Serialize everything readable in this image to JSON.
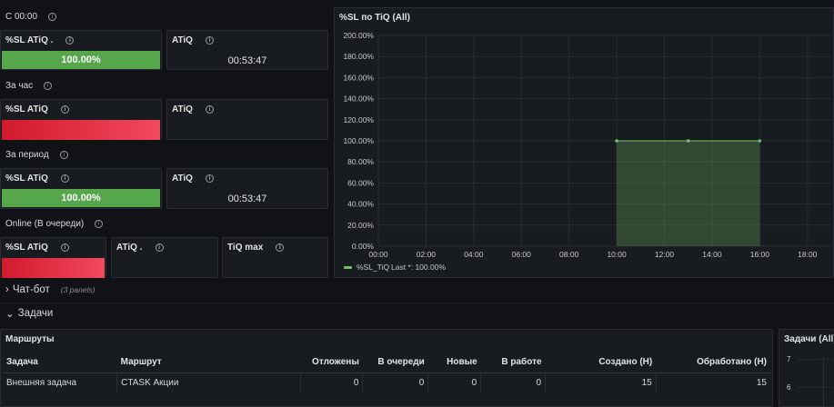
{
  "sections": {
    "s1": "С 00:00",
    "s2": "За час",
    "s3": "За период",
    "s4": "Online (В очереди)"
  },
  "panels": {
    "p1": {
      "title": "%SL ATiQ .",
      "value": "100.00%",
      "status": "green"
    },
    "p2": {
      "title": "ATiQ",
      "value": "00:53:47"
    },
    "p3": {
      "title": "%SL ATiQ",
      "value": "",
      "status": "red"
    },
    "p4": {
      "title": "ATiQ",
      "value": ""
    },
    "p5": {
      "title": "%SL ATiQ",
      "value": "100.00%",
      "status": "green"
    },
    "p6": {
      "title": "ATiQ",
      "value": "00:53:47"
    },
    "p7": {
      "title": "%SL ATiQ",
      "value": "",
      "status": "red"
    },
    "p8": {
      "title": "ATiQ .",
      "value": ""
    },
    "p9": {
      "title": "TiQ max",
      "value": ""
    }
  },
  "chart_panel": {
    "title": "%SL по TiQ (All)"
  },
  "chart_data": {
    "type": "area",
    "y_ticks": [
      "0.00%",
      "20.00%",
      "40.00%",
      "60.00%",
      "80.00%",
      "100.00%",
      "120.00%",
      "140.00%",
      "160.00%",
      "180.00%",
      "200.00%"
    ],
    "x_ticks": [
      "00:00",
      "02:00",
      "04:00",
      "06:00",
      "08:00",
      "10:00",
      "12:00",
      "14:00",
      "16:00",
      "18:00"
    ],
    "ylim": [
      0,
      200
    ],
    "xlim_hours": [
      0,
      18
    ],
    "series": [
      {
        "name": "%SL_TiQ",
        "x_hours": [
          10,
          13,
          16
        ],
        "values": [
          100,
          100,
          100
        ],
        "color": "#73bf69"
      }
    ],
    "legend": {
      "label": "%SL_TiQ",
      "stat": "Last *: 100.00%"
    }
  },
  "rows": {
    "chatbot": {
      "label": "Чат-бот",
      "count": "(3 panels)"
    },
    "tasks": {
      "label": "Задачи"
    }
  },
  "routes_table": {
    "title": "Маршруты",
    "columns": [
      "Задача",
      "Маршрут",
      "Отложены",
      "В очереди",
      "Новые",
      "В работе",
      "Создано (Н)",
      "Обработано (Н)"
    ],
    "rows": [
      [
        "Внешняя задача",
        "CTASK Акции",
        "0",
        "0",
        "0",
        "0",
        "15",
        "15"
      ]
    ]
  },
  "tasks_panel": {
    "title": "Задачи (All)",
    "y_ticks": [
      "7",
      "6"
    ]
  },
  "colors": {
    "green": "#56a64b",
    "red": "#e02f44",
    "background": "#111217",
    "panel": "#181b1f"
  }
}
